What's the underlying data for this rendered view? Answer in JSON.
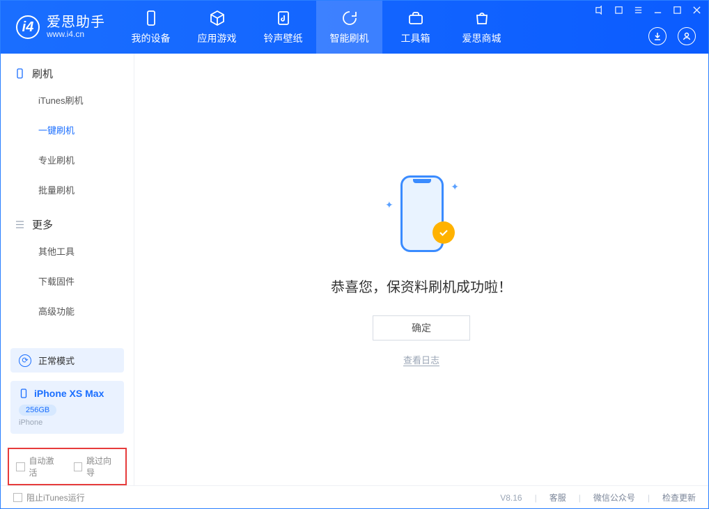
{
  "app": {
    "title": "爱思助手",
    "url": "www.i4.cn"
  },
  "nav": {
    "tabs": [
      {
        "label": "我的设备"
      },
      {
        "label": "应用游戏"
      },
      {
        "label": "铃声壁纸"
      },
      {
        "label": "智能刷机"
      },
      {
        "label": "工具箱"
      },
      {
        "label": "爱思商城"
      }
    ]
  },
  "sidebar": {
    "flash_section": "刷机",
    "flash_items": [
      "iTunes刷机",
      "一键刷机",
      "专业刷机",
      "批量刷机"
    ],
    "more_section": "更多",
    "more_items": [
      "其他工具",
      "下载固件",
      "高级功能"
    ]
  },
  "device": {
    "mode_label": "正常模式",
    "name": "iPhone XS Max",
    "storage": "256GB",
    "type": "iPhone"
  },
  "options": {
    "auto_activate": "自动激活",
    "skip_wizard": "跳过向导"
  },
  "main": {
    "success_message": "恭喜您，保资料刷机成功啦！",
    "ok_button": "确定",
    "view_log": "查看日志"
  },
  "footer": {
    "block_itunes": "阻止iTunes运行",
    "version": "V8.16",
    "links": [
      "客服",
      "微信公众号",
      "检查更新"
    ]
  },
  "colors": {
    "primary": "#1a6eff",
    "accent": "#ffb200"
  }
}
